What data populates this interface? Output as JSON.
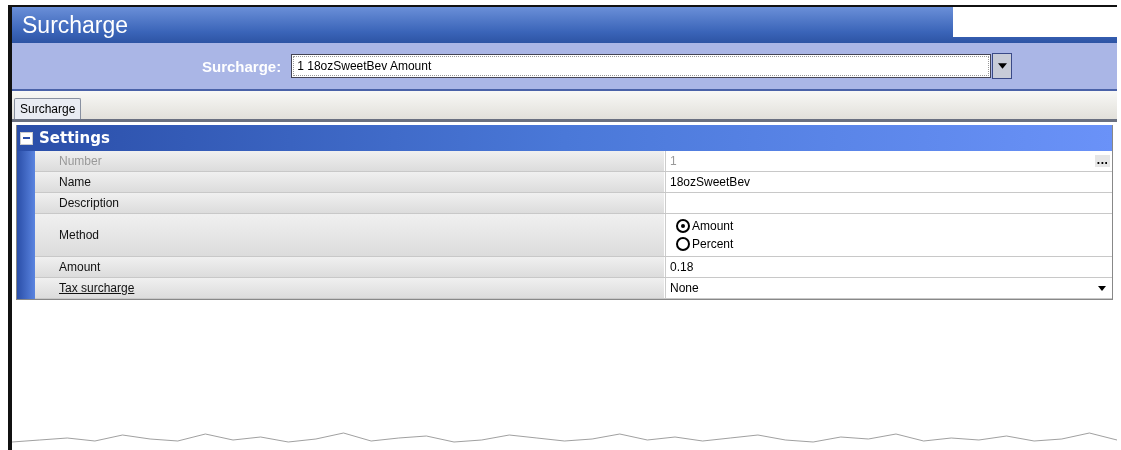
{
  "window": {
    "title": "Surcharge"
  },
  "selector": {
    "label": "Surcharge:",
    "value": "1 18ozSweetBev Amount"
  },
  "tabs": [
    {
      "label": "Surcharge",
      "selected": true
    }
  ],
  "section": {
    "title": "Settings",
    "expanded": true
  },
  "rows": [
    {
      "kind": "text",
      "label": "Number",
      "value": "1",
      "disabled": true,
      "button": "..."
    },
    {
      "kind": "text",
      "label": "Name",
      "value": "18ozSweetBev",
      "disabled": false
    },
    {
      "kind": "text",
      "label": "Description",
      "disabled": false
    },
    {
      "kind": "radio",
      "label": "Method",
      "disabled": false,
      "options": [
        {
          "label": "Amount",
          "selected": true
        },
        {
          "label": "Percent",
          "selected": false
        }
      ]
    },
    {
      "kind": "text",
      "label": "Amount",
      "value": "0.18",
      "disabled": false
    },
    {
      "kind": "dropdown",
      "label": "Tax surcharge",
      "value": "None",
      "disabled": false,
      "underlined": true
    }
  ]
}
